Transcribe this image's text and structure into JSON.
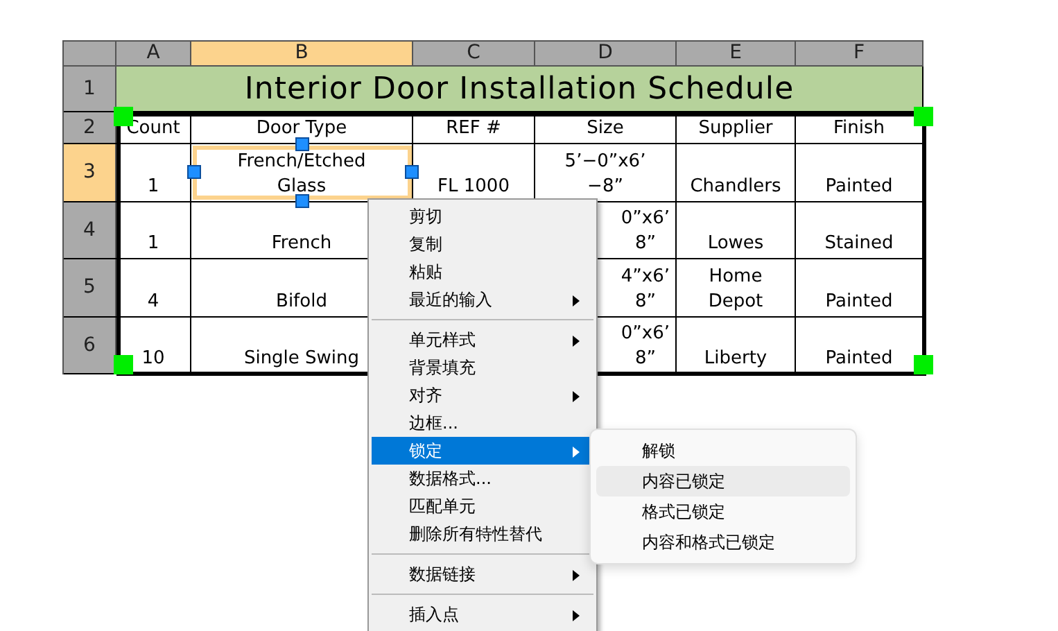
{
  "columns": [
    {
      "label": "A",
      "selected": false
    },
    {
      "label": "B",
      "selected": true
    },
    {
      "label": "C",
      "selected": false
    },
    {
      "label": "D",
      "selected": false
    },
    {
      "label": "E",
      "selected": false
    },
    {
      "label": "F",
      "selected": false
    }
  ],
  "rows": [
    {
      "header": "1",
      "selected": false,
      "kind": "title",
      "title": "Interior Door Installation Schedule"
    },
    {
      "header": "2",
      "selected": false,
      "kind": "cells",
      "cells": [
        {
          "lines": [
            "Count"
          ],
          "selected": false
        },
        {
          "lines": [
            "Door Type"
          ],
          "selected": false
        },
        {
          "lines": [
            "REF #"
          ],
          "selected": false
        },
        {
          "lines": [
            "Size"
          ],
          "selected": false
        },
        {
          "lines": [
            "Supplier"
          ],
          "selected": false
        },
        {
          "lines": [
            "Finish"
          ],
          "selected": false
        }
      ]
    },
    {
      "header": "3",
      "selected": true,
      "kind": "cells",
      "cells": [
        {
          "lines": [
            "1"
          ],
          "selected": false
        },
        {
          "lines": [
            "French/Etched",
            "Glass"
          ],
          "selected": true
        },
        {
          "lines": [
            "FL 1000"
          ],
          "selected": false
        },
        {
          "lines": [
            "5’−0”x6’",
            "−8”"
          ],
          "selected": false
        },
        {
          "lines": [
            "Chandlers"
          ],
          "selected": false
        },
        {
          "lines": [
            "Painted"
          ],
          "selected": false
        }
      ]
    },
    {
      "header": "4",
      "selected": false,
      "kind": "cells",
      "cells": [
        {
          "lines": [
            "1"
          ],
          "selected": false
        },
        {
          "lines": [
            "French"
          ],
          "selected": false
        },
        null,
        {
          "lines": [
            "0”x6’",
            "8”"
          ],
          "selected": false,
          "clipped": true
        },
        {
          "lines": [
            "Lowes"
          ],
          "selected": false
        },
        {
          "lines": [
            "Stained"
          ],
          "selected": false
        }
      ]
    },
    {
      "header": "5",
      "selected": false,
      "kind": "cells",
      "cells": [
        {
          "lines": [
            "4"
          ],
          "selected": false
        },
        {
          "lines": [
            "Bifold"
          ],
          "selected": false
        },
        null,
        {
          "lines": [
            "4”x6’",
            "8”"
          ],
          "selected": false,
          "clipped": true
        },
        {
          "lines": [
            "Home",
            "Depot"
          ],
          "selected": false
        },
        {
          "lines": [
            "Painted"
          ],
          "selected": false
        }
      ]
    },
    {
      "header": "6",
      "selected": false,
      "kind": "cells",
      "cells": [
        {
          "lines": [
            "10"
          ],
          "selected": false
        },
        {
          "lines": [
            "Single Swing"
          ],
          "selected": false
        },
        null,
        {
          "lines": [
            "0”x6’",
            "8”"
          ],
          "selected": false,
          "clipped": true
        },
        {
          "lines": [
            "Liberty"
          ],
          "selected": false
        },
        {
          "lines": [
            "Painted"
          ],
          "selected": false
        }
      ]
    }
  ],
  "context_menu": {
    "items": [
      {
        "kind": "item",
        "label": "剪切",
        "submenu": false,
        "selected": false
      },
      {
        "kind": "item",
        "label": "复制",
        "submenu": false,
        "selected": false
      },
      {
        "kind": "item",
        "label": "粘贴",
        "submenu": false,
        "selected": false
      },
      {
        "kind": "item",
        "label": "最近的输入",
        "submenu": true,
        "selected": false
      },
      {
        "kind": "separator"
      },
      {
        "kind": "item",
        "label": "单元样式",
        "submenu": true,
        "selected": false
      },
      {
        "kind": "item",
        "label": "背景填充",
        "submenu": false,
        "selected": false
      },
      {
        "kind": "item",
        "label": "对齐",
        "submenu": true,
        "selected": false
      },
      {
        "kind": "item",
        "label": "边框...",
        "submenu": false,
        "selected": false
      },
      {
        "kind": "item",
        "label": "锁定",
        "submenu": true,
        "selected": true
      },
      {
        "kind": "item",
        "label": "数据格式...",
        "submenu": false,
        "selected": false
      },
      {
        "kind": "item",
        "label": "匹配单元",
        "submenu": false,
        "selected": false
      },
      {
        "kind": "item",
        "label": "删除所有特性替代",
        "submenu": false,
        "selected": false
      },
      {
        "kind": "separator"
      },
      {
        "kind": "item",
        "label": "数据链接",
        "submenu": true,
        "selected": false
      },
      {
        "kind": "separator"
      },
      {
        "kind": "item",
        "label": "插入点",
        "submenu": true,
        "selected": false
      }
    ]
  },
  "submenu": {
    "items": [
      {
        "label": "解锁",
        "selected": false
      },
      {
        "label": "内容已锁定",
        "selected": true
      },
      {
        "label": "格式已锁定",
        "selected": false
      },
      {
        "label": "内容和格式已锁定",
        "selected": false
      }
    ]
  }
}
